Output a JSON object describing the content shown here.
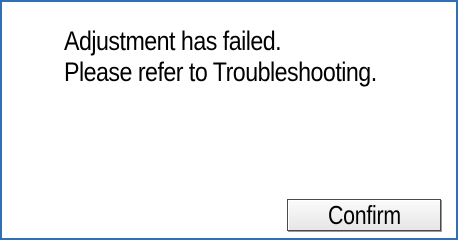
{
  "dialog": {
    "message_lines": [
      "Adjustment has failed.",
      "Please refer to Troubleshooting."
    ],
    "confirm_label": "Confirm"
  },
  "colors": {
    "border": "#2e6fb5",
    "background": "#ffffff",
    "text": "#000000"
  }
}
